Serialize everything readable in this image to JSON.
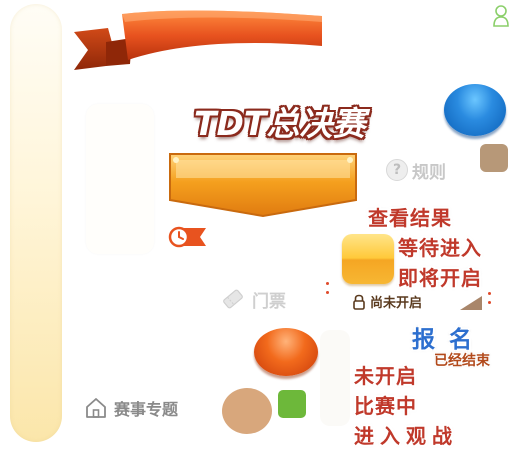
{
  "title": "TDT总决赛",
  "rules": {
    "label": "规则"
  },
  "ticket": {
    "label": "门票"
  },
  "status": {
    "view_results": "查看结果",
    "waiting": "等待进入",
    "opening_soon": "即将开启",
    "not_open_lock": "尚未开启",
    "register": "报名",
    "ended": "已经结束",
    "not_open": "未开启",
    "in_match": "比赛中",
    "enter_watch": "进入观战"
  },
  "home": {
    "label": "赛事专题"
  },
  "colors": {
    "ribbon": "#e8531f",
    "plate": "#f5a01e",
    "blue_button": "#1f7fd6",
    "orange_button": "#ec5a12",
    "green": "#6db83a",
    "tan": "#d8a77c",
    "brown": "#b79878",
    "status_text": "#c0392b",
    "register_text": "#2d6fcf"
  },
  "icons": [
    "person-icon",
    "question-icon",
    "clock-icon",
    "ticket-icon",
    "lock-icon",
    "home-icon"
  ]
}
